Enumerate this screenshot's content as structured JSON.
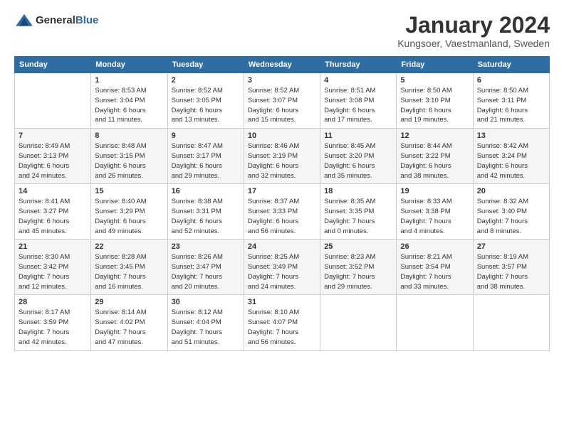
{
  "header": {
    "logo_general": "General",
    "logo_blue": "Blue",
    "month": "January 2024",
    "location": "Kungsoer, Vaestmanland, Sweden"
  },
  "weekdays": [
    "Sunday",
    "Monday",
    "Tuesday",
    "Wednesday",
    "Thursday",
    "Friday",
    "Saturday"
  ],
  "weeks": [
    [
      {
        "day": "",
        "sunrise": "",
        "sunset": "",
        "daylight": ""
      },
      {
        "day": "1",
        "sunrise": "Sunrise: 8:53 AM",
        "sunset": "Sunset: 3:04 PM",
        "daylight": "Daylight: 6 hours",
        "daylight2": "and 11 minutes."
      },
      {
        "day": "2",
        "sunrise": "Sunrise: 8:52 AM",
        "sunset": "Sunset: 3:05 PM",
        "daylight": "Daylight: 6 hours",
        "daylight2": "and 13 minutes."
      },
      {
        "day": "3",
        "sunrise": "Sunrise: 8:52 AM",
        "sunset": "Sunset: 3:07 PM",
        "daylight": "Daylight: 6 hours",
        "daylight2": "and 15 minutes."
      },
      {
        "day": "4",
        "sunrise": "Sunrise: 8:51 AM",
        "sunset": "Sunset: 3:08 PM",
        "daylight": "Daylight: 6 hours",
        "daylight2": "and 17 minutes."
      },
      {
        "day": "5",
        "sunrise": "Sunrise: 8:50 AM",
        "sunset": "Sunset: 3:10 PM",
        "daylight": "Daylight: 6 hours",
        "daylight2": "and 19 minutes."
      },
      {
        "day": "6",
        "sunrise": "Sunrise: 8:50 AM",
        "sunset": "Sunset: 3:11 PM",
        "daylight": "Daylight: 6 hours",
        "daylight2": "and 21 minutes."
      }
    ],
    [
      {
        "day": "7",
        "sunrise": "Sunrise: 8:49 AM",
        "sunset": "Sunset: 3:13 PM",
        "daylight": "Daylight: 6 hours",
        "daylight2": "and 24 minutes."
      },
      {
        "day": "8",
        "sunrise": "Sunrise: 8:48 AM",
        "sunset": "Sunset: 3:15 PM",
        "daylight": "Daylight: 6 hours",
        "daylight2": "and 26 minutes."
      },
      {
        "day": "9",
        "sunrise": "Sunrise: 8:47 AM",
        "sunset": "Sunset: 3:17 PM",
        "daylight": "Daylight: 6 hours",
        "daylight2": "and 29 minutes."
      },
      {
        "day": "10",
        "sunrise": "Sunrise: 8:46 AM",
        "sunset": "Sunset: 3:19 PM",
        "daylight": "Daylight: 6 hours",
        "daylight2": "and 32 minutes."
      },
      {
        "day": "11",
        "sunrise": "Sunrise: 8:45 AM",
        "sunset": "Sunset: 3:20 PM",
        "daylight": "Daylight: 6 hours",
        "daylight2": "and 35 minutes."
      },
      {
        "day": "12",
        "sunrise": "Sunrise: 8:44 AM",
        "sunset": "Sunset: 3:22 PM",
        "daylight": "Daylight: 6 hours",
        "daylight2": "and 38 minutes."
      },
      {
        "day": "13",
        "sunrise": "Sunrise: 8:42 AM",
        "sunset": "Sunset: 3:24 PM",
        "daylight": "Daylight: 6 hours",
        "daylight2": "and 42 minutes."
      }
    ],
    [
      {
        "day": "14",
        "sunrise": "Sunrise: 8:41 AM",
        "sunset": "Sunset: 3:27 PM",
        "daylight": "Daylight: 6 hours",
        "daylight2": "and 45 minutes."
      },
      {
        "day": "15",
        "sunrise": "Sunrise: 8:40 AM",
        "sunset": "Sunset: 3:29 PM",
        "daylight": "Daylight: 6 hours",
        "daylight2": "and 49 minutes."
      },
      {
        "day": "16",
        "sunrise": "Sunrise: 8:38 AM",
        "sunset": "Sunset: 3:31 PM",
        "daylight": "Daylight: 6 hours",
        "daylight2": "and 52 minutes."
      },
      {
        "day": "17",
        "sunrise": "Sunrise: 8:37 AM",
        "sunset": "Sunset: 3:33 PM",
        "daylight": "Daylight: 6 hours",
        "daylight2": "and 56 minutes."
      },
      {
        "day": "18",
        "sunrise": "Sunrise: 8:35 AM",
        "sunset": "Sunset: 3:35 PM",
        "daylight": "Daylight: 7 hours",
        "daylight2": "and 0 minutes."
      },
      {
        "day": "19",
        "sunrise": "Sunrise: 8:33 AM",
        "sunset": "Sunset: 3:38 PM",
        "daylight": "Daylight: 7 hours",
        "daylight2": "and 4 minutes."
      },
      {
        "day": "20",
        "sunrise": "Sunrise: 8:32 AM",
        "sunset": "Sunset: 3:40 PM",
        "daylight": "Daylight: 7 hours",
        "daylight2": "and 8 minutes."
      }
    ],
    [
      {
        "day": "21",
        "sunrise": "Sunrise: 8:30 AM",
        "sunset": "Sunset: 3:42 PM",
        "daylight": "Daylight: 7 hours",
        "daylight2": "and 12 minutes."
      },
      {
        "day": "22",
        "sunrise": "Sunrise: 8:28 AM",
        "sunset": "Sunset: 3:45 PM",
        "daylight": "Daylight: 7 hours",
        "daylight2": "and 16 minutes."
      },
      {
        "day": "23",
        "sunrise": "Sunrise: 8:26 AM",
        "sunset": "Sunset: 3:47 PM",
        "daylight": "Daylight: 7 hours",
        "daylight2": "and 20 minutes."
      },
      {
        "day": "24",
        "sunrise": "Sunrise: 8:25 AM",
        "sunset": "Sunset: 3:49 PM",
        "daylight": "Daylight: 7 hours",
        "daylight2": "and 24 minutes."
      },
      {
        "day": "25",
        "sunrise": "Sunrise: 8:23 AM",
        "sunset": "Sunset: 3:52 PM",
        "daylight": "Daylight: 7 hours",
        "daylight2": "and 29 minutes."
      },
      {
        "day": "26",
        "sunrise": "Sunrise: 8:21 AM",
        "sunset": "Sunset: 3:54 PM",
        "daylight": "Daylight: 7 hours",
        "daylight2": "and 33 minutes."
      },
      {
        "day": "27",
        "sunrise": "Sunrise: 8:19 AM",
        "sunset": "Sunset: 3:57 PM",
        "daylight": "Daylight: 7 hours",
        "daylight2": "and 38 minutes."
      }
    ],
    [
      {
        "day": "28",
        "sunrise": "Sunrise: 8:17 AM",
        "sunset": "Sunset: 3:59 PM",
        "daylight": "Daylight: 7 hours",
        "daylight2": "and 42 minutes."
      },
      {
        "day": "29",
        "sunrise": "Sunrise: 8:14 AM",
        "sunset": "Sunset: 4:02 PM",
        "daylight": "Daylight: 7 hours",
        "daylight2": "and 47 minutes."
      },
      {
        "day": "30",
        "sunrise": "Sunrise: 8:12 AM",
        "sunset": "Sunset: 4:04 PM",
        "daylight": "Daylight: 7 hours",
        "daylight2": "and 51 minutes."
      },
      {
        "day": "31",
        "sunrise": "Sunrise: 8:10 AM",
        "sunset": "Sunset: 4:07 PM",
        "daylight": "Daylight: 7 hours",
        "daylight2": "and 56 minutes."
      },
      {
        "day": "",
        "sunrise": "",
        "sunset": "",
        "daylight": ""
      },
      {
        "day": "",
        "sunrise": "",
        "sunset": "",
        "daylight": ""
      },
      {
        "day": "",
        "sunrise": "",
        "sunset": "",
        "daylight": ""
      }
    ]
  ]
}
